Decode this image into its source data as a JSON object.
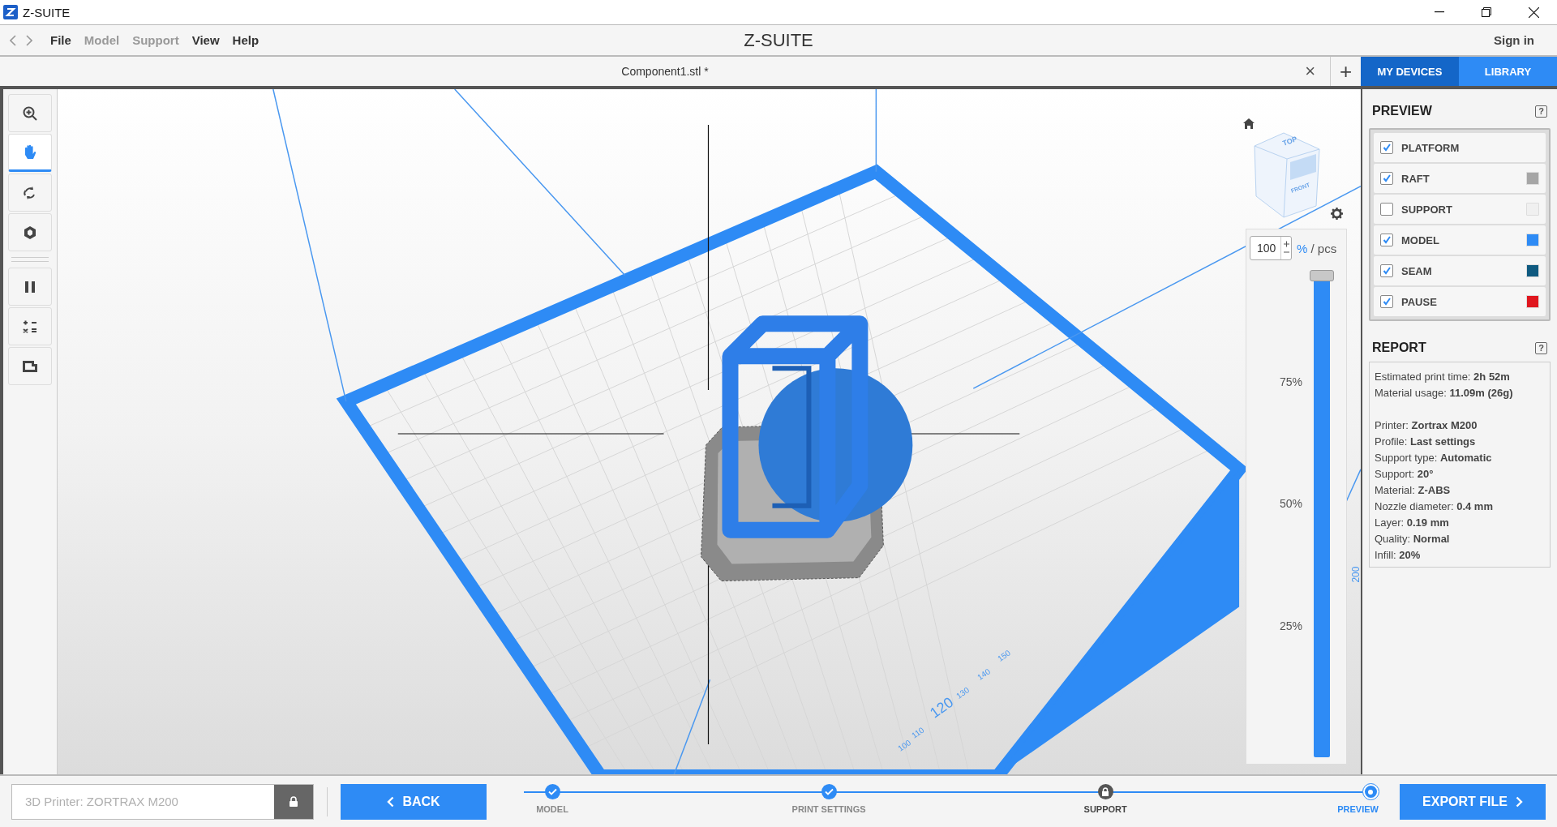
{
  "window": {
    "title": "Z-SUITE"
  },
  "menu": {
    "items": [
      {
        "label": "File",
        "disabled": false
      },
      {
        "label": "Model",
        "disabled": true
      },
      {
        "label": "Support",
        "disabled": true
      },
      {
        "label": "View",
        "disabled": false
      },
      {
        "label": "Help",
        "disabled": false
      }
    ],
    "logo": "Z-SUITE",
    "sign_in": "Sign in"
  },
  "file_tab": {
    "title": "Component1.stl *",
    "close": "×",
    "add": "+"
  },
  "side_tabs": [
    {
      "label": "MY DEVICES",
      "selected": true
    },
    {
      "label": "LIBRARY",
      "selected": false
    }
  ],
  "tools": [
    {
      "kind": "zoom",
      "selected": false
    },
    {
      "kind": "pan",
      "selected": true
    },
    {
      "kind": "rotate",
      "selected": false
    },
    {
      "kind": "view",
      "selected": false
    },
    {
      "kind": "separator"
    },
    {
      "kind": "pause",
      "selected": false
    },
    {
      "kind": "calc",
      "selected": false
    },
    {
      "kind": "layers",
      "selected": false
    }
  ],
  "viewport": {
    "cube_labels": [
      "TOP",
      "FRONT"
    ],
    "ruler": [
      "100",
      "110",
      "120",
      "130",
      "140",
      "150"
    ],
    "ruler_edge": "200",
    "layers": {
      "value": "100",
      "unit": "%",
      "pcs": "/ pcs",
      "level": 1,
      "ticks": [
        "75%",
        "50%",
        "25%"
      ]
    }
  },
  "preview": {
    "title": "PREVIEW",
    "help": "?",
    "items": [
      {
        "label": "PLATFORM",
        "checked": true
      },
      {
        "label": "RAFT",
        "checked": true,
        "color": "#a6a6a6"
      },
      {
        "label": "SUPPORT",
        "checked": false,
        "color": "#f0f0f0"
      },
      {
        "label": "MODEL",
        "checked": true,
        "color": "#2e8bf5"
      },
      {
        "label": "SEAM",
        "checked": true,
        "color": "#0f5a80"
      },
      {
        "label": "PAUSE",
        "checked": true,
        "color": "#e0161e"
      }
    ]
  },
  "report": {
    "title": "REPORT",
    "help": "?",
    "groups": [
      [
        "Estimated print time: **2h 52m**",
        "Material usage: **11.09m (26g)**"
      ],
      [
        "Printer: **Zortrax M200**",
        "Profile: **Last settings**",
        "Support type: **Automatic**",
        "Support: **20°**",
        "Material: **Z-ABS**",
        "Nozzle diameter: **0.4 mm**",
        "Layer: **0.19 mm**",
        "Quality: **Normal**",
        "Infill: **20%**"
      ]
    ]
  },
  "bottom": {
    "printer_placeholder": "3D Printer: ZORTRAX M200",
    "back": "BACK",
    "export": "EXPORT FILE",
    "steps": [
      {
        "label": "MODEL",
        "completed": true,
        "locked": false,
        "selected": false
      },
      {
        "label": "PRINT SETTINGS",
        "completed": true,
        "locked": false,
        "selected": false
      },
      {
        "label": "SUPPORT",
        "completed": false,
        "locked": true,
        "selected": false
      },
      {
        "label": "PREVIEW",
        "completed": false,
        "locked": false,
        "selected": true
      }
    ]
  }
}
